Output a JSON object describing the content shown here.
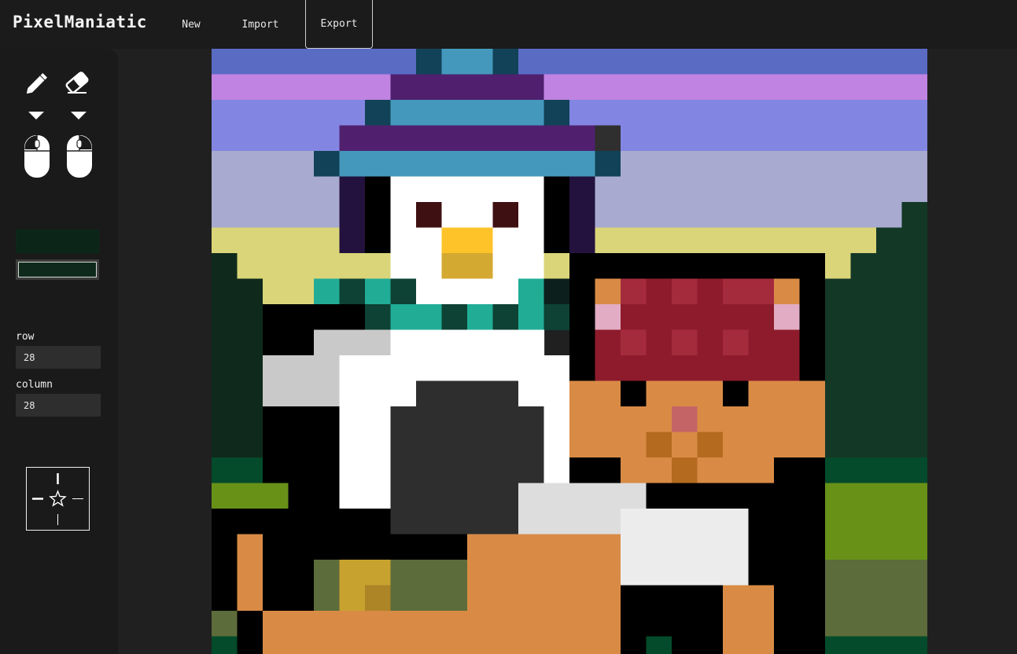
{
  "app": {
    "title": "PixelManiatic"
  },
  "nav": {
    "new_label": "New",
    "import_label": "Import",
    "export_label": "Export"
  },
  "tools": {
    "left_tool": "pencil-icon",
    "right_tool": "eraser-icon",
    "primary_color": "#0b2618",
    "secondary_color": "#0f2a1c"
  },
  "grid": {
    "row_label": "row",
    "row_value": "28",
    "column_label": "column",
    "column_value": "28"
  },
  "symmetry": {
    "icon": "star-crosshair-icon"
  },
  "palette": {
    "A": "#5a6bc4",
    "B": "#c183e1",
    "C": "#8286e2",
    "D": "#a8aad0",
    "E": "#dad579",
    "F": "#133826",
    "G": "#0f2a1c",
    "H": "#034b2a",
    "I": "#689118",
    "J": "#5c6c3a",
    "K": "#000000",
    "L": "#0d1f1c",
    "M": "#4498bc",
    "N": "#114257",
    "O": "#50206f",
    "P": "#23123e",
    "Q": "#ffffff",
    "R": "#3f1011",
    "S": "#fdc329",
    "T": "#d4a932",
    "U": "#21ac96",
    "V": "#0d4234",
    "W": "#c9c9c9",
    "X": "#2e2e2e",
    "Y": "#d98b46",
    "Z": "#a42b3b",
    "a": "#8e1b2c",
    "b": "#e2acc4",
    "c": "#c46466",
    "d": "#b46b1f",
    "e": "#dddddd",
    "f": "#ececec",
    "g": "#c8a22e",
    "h": "#ad8426",
    "i": "#2f2f2f"
  }
}
